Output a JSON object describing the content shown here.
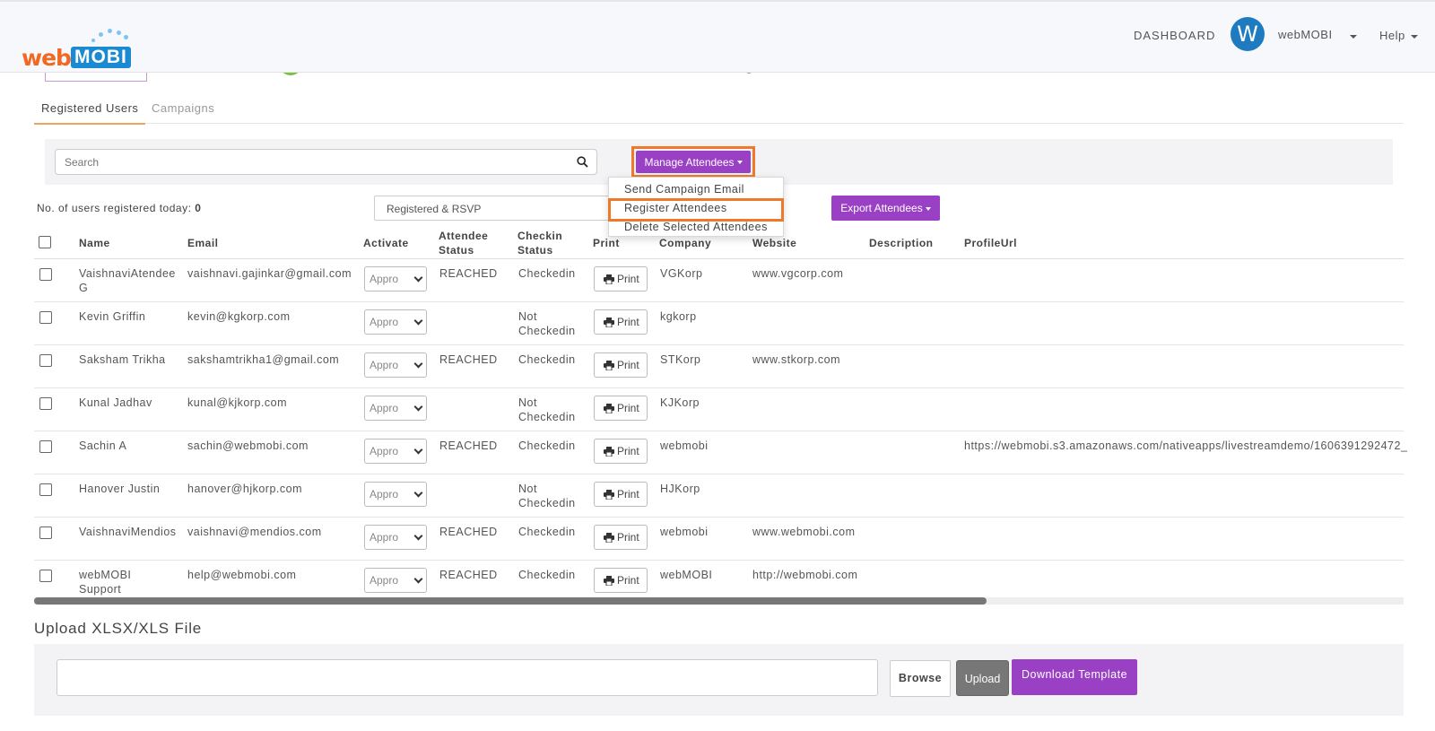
{
  "brand": {
    "logo_web": "web",
    "logo_mobi": "MOBI"
  },
  "nav": {
    "dashboard": "DASHBOARD",
    "avatar_initial": "W",
    "user": "webMOBI",
    "help": "Help"
  },
  "tabs": {
    "registered": "Registered Users",
    "campaigns": "Campaigns"
  },
  "search": {
    "placeholder": "Search"
  },
  "manage": {
    "label": "Manage Attendees",
    "menu": [
      "Send Campaign Email",
      "Register Attendees",
      "Delete Selected Attendees"
    ],
    "highlighted_index": 1
  },
  "registered_today": {
    "label": "No. of users registered today:",
    "count": "0"
  },
  "filter": {
    "selected": "Registered & RSVP"
  },
  "export": {
    "label": "Export Attendees"
  },
  "table": {
    "headers": {
      "name": "Name",
      "email": "Email",
      "activate": "Activate",
      "attendee_status_1": "Attendee",
      "attendee_status_2": "Status",
      "checkin_status_1": "Checkin",
      "checkin_status_2": "Status",
      "print": "Print",
      "company": "Company",
      "website": "Website",
      "description": "Description",
      "profile_url": "ProfileUrl"
    },
    "activate_value": "Appro",
    "print_label": "Print",
    "rows": [
      {
        "name1": "VaishnaviAtendee",
        "name2": "G",
        "email": "vaishnavi.gajinkar@gmail.com",
        "status": "REACHED",
        "checkin1": "Checkedin",
        "checkin2": "",
        "company": "VGKorp",
        "website": "www.vgcorp.com",
        "profile": ""
      },
      {
        "name1": "Kevin Griffin",
        "name2": "",
        "email": "kevin@kgkorp.com",
        "status": "",
        "checkin1": "Not",
        "checkin2": "Checkedin",
        "company": "kgkorp",
        "website": "",
        "profile": ""
      },
      {
        "name1": "Saksham Trikha",
        "name2": "",
        "email": "sakshamtrikha1@gmail.com",
        "status": "REACHED",
        "checkin1": "Checkedin",
        "checkin2": "",
        "company": "STKorp",
        "website": "www.stkorp.com",
        "profile": ""
      },
      {
        "name1": "Kunal Jadhav",
        "name2": "",
        "email": "kunal@kjkorp.com",
        "status": "",
        "checkin1": "Not",
        "checkin2": "Checkedin",
        "company": "KJKorp",
        "website": "",
        "profile": ""
      },
      {
        "name1": "Sachin A",
        "name2": "",
        "email": "sachin@webmobi.com",
        "status": "REACHED",
        "checkin1": "Checkedin",
        "checkin2": "",
        "company": "webmobi",
        "website": "",
        "profile": "https://webmobi.s3.amazonaws.com/nativeapps/livestreamdemo/1606391292472_"
      },
      {
        "name1": "Hanover Justin",
        "name2": "",
        "email": "hanover@hjkorp.com",
        "status": "",
        "checkin1": "Not",
        "checkin2": "Checkedin",
        "company": "HJKorp",
        "website": "",
        "profile": ""
      },
      {
        "name1": "VaishnaviMendios",
        "name2": "",
        "email": "vaishnavi@mendios.com",
        "status": "REACHED",
        "checkin1": "Checkedin",
        "checkin2": "",
        "company": "webmobi",
        "website": "www.webmobi.com",
        "profile": ""
      },
      {
        "name1": "webMOBI",
        "name2": "Support",
        "email": "help@webmobi.com",
        "status": "REACHED",
        "checkin1": "Checkedin",
        "checkin2": "",
        "company": "webMOBI",
        "website": "http://webmobi.com",
        "profile": ""
      }
    ]
  },
  "upload": {
    "title": "Upload XLSX/XLS File",
    "browse": "Browse",
    "upload": "Upload",
    "download_template": "Download Template"
  },
  "colors": {
    "accent_purple": "#9a40c4",
    "highlight_orange": "#f0782a",
    "avatar_blue": "#1f7bbf"
  }
}
